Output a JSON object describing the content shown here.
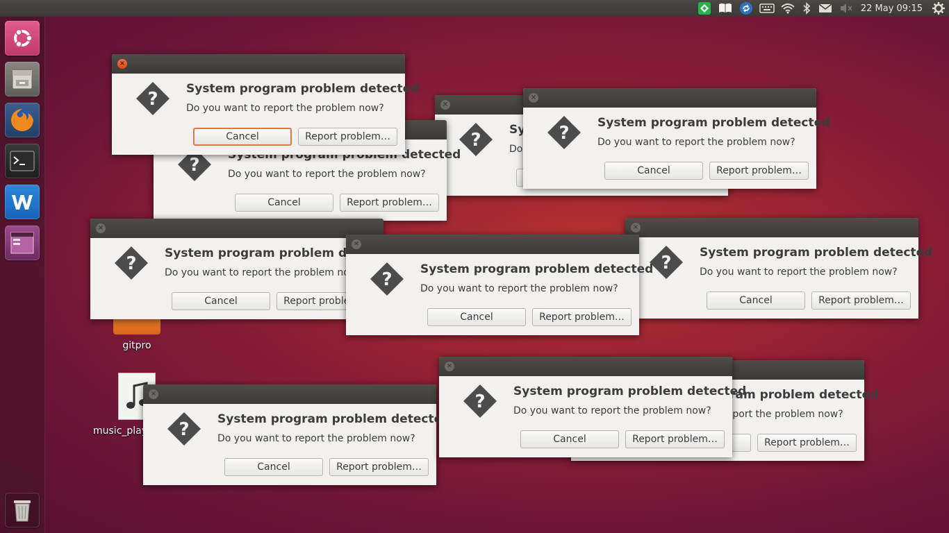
{
  "panel": {
    "clock": "22 May 09:15",
    "indicators": [
      "app-indicator-icon",
      "book-icon",
      "sync-icon",
      "keyboard-icon",
      "wifi-icon",
      "bluetooth-icon",
      "mail-icon",
      "volume-muted-icon",
      "session-gear-icon"
    ]
  },
  "launcher": {
    "items": [
      "ubuntu-dash",
      "files",
      "firefox",
      "terminal",
      "writer",
      "workspace-switcher"
    ],
    "trash": "trash"
  },
  "desktop": {
    "icons": [
      {
        "label": "gitpro"
      },
      {
        "label": "music_play"
      }
    ]
  },
  "dialog": {
    "title": "System program problem detected",
    "message": "Do you want to report the problem now?",
    "cancel_label": "Cancel",
    "report_label": "Report problem…"
  },
  "colors": {
    "accent_orange": "#e0764a",
    "titlebar": "#3c3b37",
    "dialog_bg": "#f2f1f0"
  }
}
